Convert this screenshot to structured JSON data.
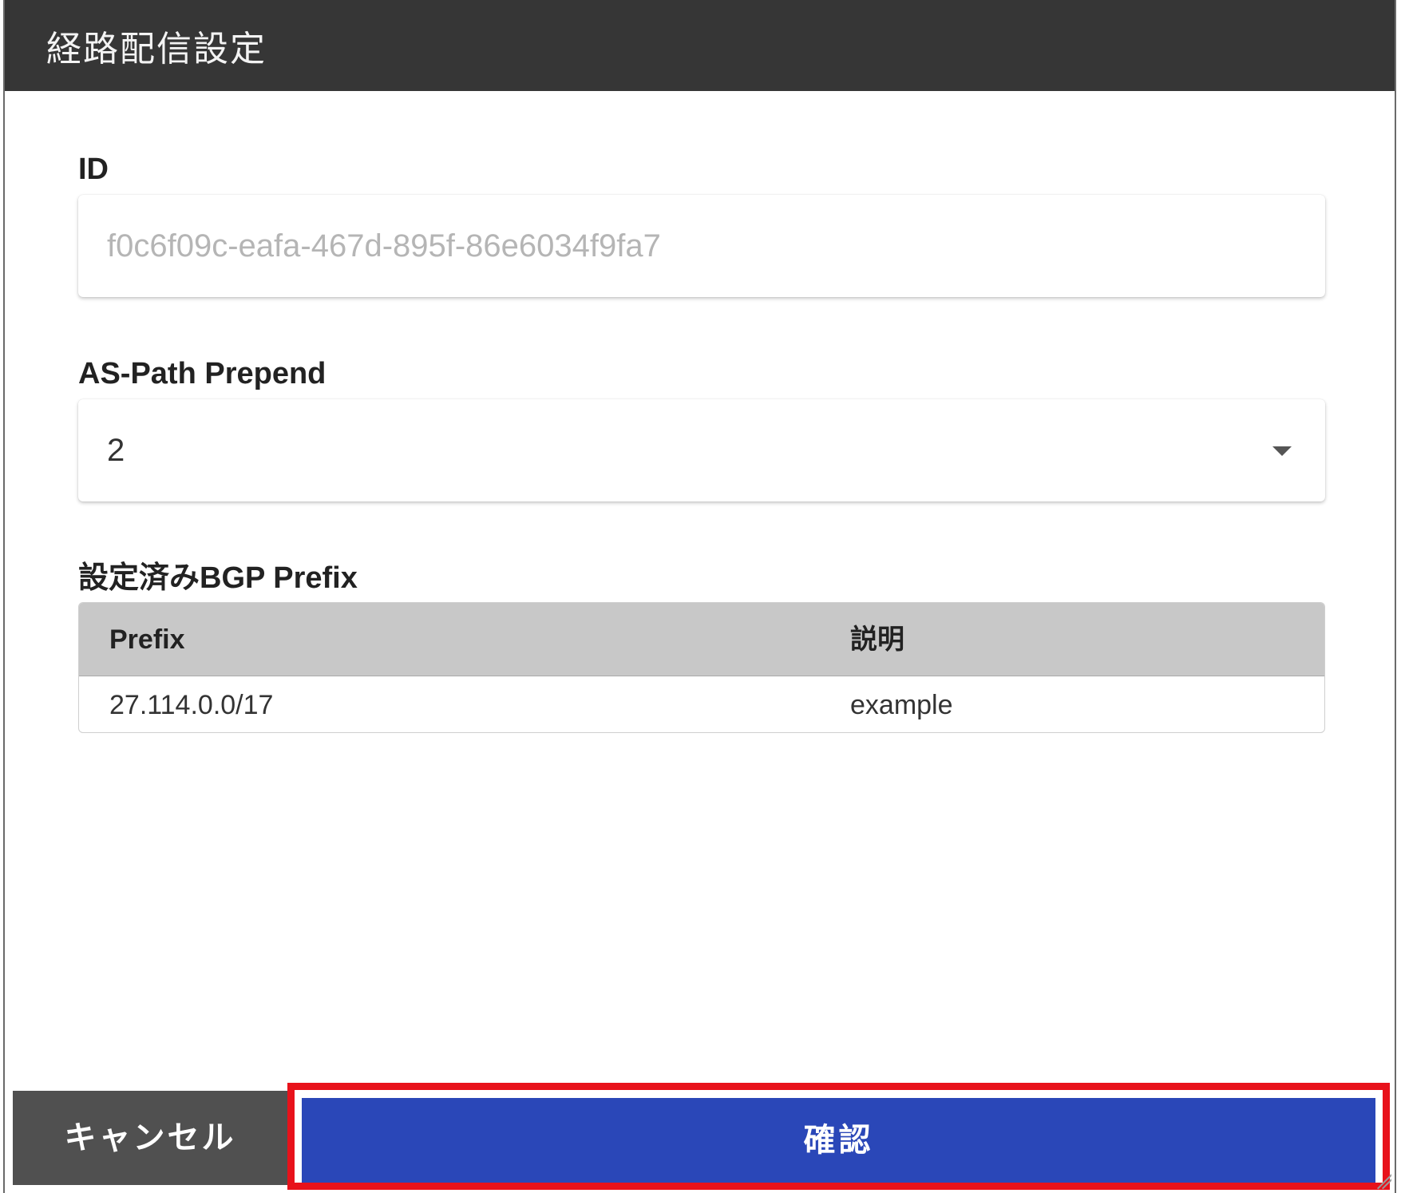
{
  "dialog": {
    "title": "経路配信設定"
  },
  "form": {
    "id": {
      "label": "ID",
      "value": "f0c6f09c-eafa-467d-895f-86e6034f9fa7"
    },
    "as_path_prepend": {
      "label": "AS-Path Prepend",
      "selected_value": "2",
      "icon": "chevron-down-icon"
    },
    "bgp_prefix": {
      "label": "設定済みBGP Prefix",
      "columns": [
        "Prefix",
        "説明"
      ],
      "rows": [
        [
          "27.114.0.0/17",
          "example"
        ]
      ]
    }
  },
  "actions": {
    "cancel_label": "キャンセル",
    "confirm_label": "確認"
  },
  "colors": {
    "title_bar": "#363636",
    "cancel_button": "#505050",
    "confirm_button": "#2a47b8",
    "highlight": "#e8121b",
    "table_header": "#c8c8c8"
  }
}
